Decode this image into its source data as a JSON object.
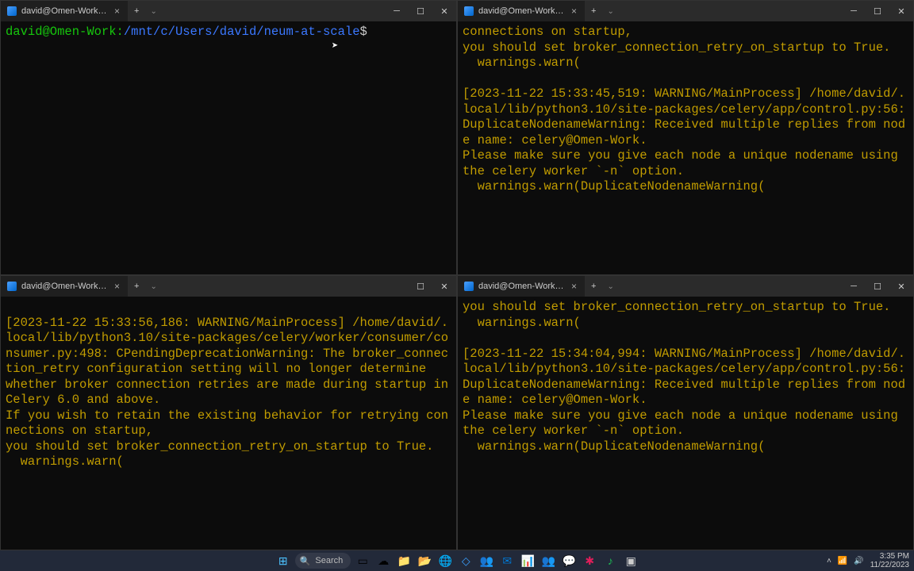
{
  "tab_title": "david@Omen-Work: /mnt/c/L",
  "prompt": {
    "user": "david@Omen-Work",
    "colon": ":",
    "path": "/mnt/c/Users/david/neum-at-scale",
    "dollar": "$"
  },
  "pane_top_right": [
    "connections on startup,",
    "you should set broker_connection_retry_on_startup to True.",
    "  warnings.warn(",
    "",
    "[2023-11-22 15:33:45,519: WARNING/MainProcess] /home/david/.local/lib/python3.10/site-packages/celery/app/control.py:56: DuplicateNodenameWarning: Received multiple replies from node name: celery@Omen-Work.",
    "Please make sure you give each node a unique nodename using",
    "the celery worker `-n` option.",
    "  warnings.warn(DuplicateNodenameWarning("
  ],
  "pane_bottom_left": [
    "",
    "[2023-11-22 15:33:56,186: WARNING/MainProcess] /home/david/.local/lib/python3.10/site-packages/celery/worker/consumer/consumer.py:498: CPendingDeprecationWarning: The broker_connection_retry configuration setting will no longer determine",
    "whether broker connection retries are made during startup in Celery 6.0 and above.",
    "If you wish to retain the existing behavior for retrying connections on startup,",
    "you should set broker_connection_retry_on_startup to True.",
    "  warnings.warn("
  ],
  "pane_bottom_right": [
    "you should set broker_connection_retry_on_startup to True.",
    "  warnings.warn(",
    "",
    "[2023-11-22 15:34:04,994: WARNING/MainProcess] /home/david/.local/lib/python3.10/site-packages/celery/app/control.py:56: DuplicateNodenameWarning: Received multiple replies from node name: celery@Omen-Work.",
    "Please make sure you give each node a unique nodename using",
    "the celery worker `-n` option.",
    "  warnings.warn(DuplicateNodenameWarning("
  ],
  "taskbar": {
    "search": "Search",
    "time": "3:35 PM",
    "date": "11/22/2023"
  }
}
